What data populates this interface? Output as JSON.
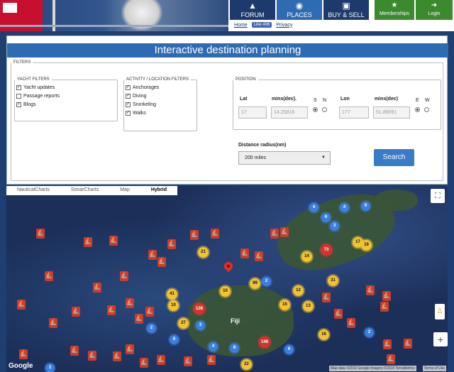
{
  "nav": {
    "tabs": [
      {
        "label": "FORUM",
        "icon": "forum-icon"
      },
      {
        "label": "PLACES",
        "icon": "place-pin-icon"
      },
      {
        "label": "BUY & SELL",
        "icon": "cart-icon"
      }
    ],
    "memberships_label": "Memberships",
    "login_label": "Login",
    "home_link": "Home",
    "like_label": "Like 406",
    "privacy_link": "Privacy"
  },
  "panel": {
    "title": "Interactive destination planning",
    "filters_legend": "FILTERS",
    "yacht_filters": {
      "legend": "YACHT FILTERS",
      "items": [
        {
          "label": "Yacht updates",
          "checked": true
        },
        {
          "label": "Passage reports",
          "checked": false
        },
        {
          "label": "Blogs",
          "checked": true
        }
      ]
    },
    "activity_filters": {
      "legend": "ACTIVITY / LOCATION FILTERS",
      "items": [
        {
          "label": "Anchorages",
          "checked": true
        },
        {
          "label": "Diving",
          "checked": true
        },
        {
          "label": "Snorkeling",
          "checked": true
        },
        {
          "label": "Walks",
          "checked": true
        }
      ]
    },
    "position": {
      "legend": "POSITION",
      "lat_label": "Lat",
      "lat_value": "17",
      "lat_mins_label": "mins(dec).",
      "lat_mins_value": "14.25816",
      "s_label": "S",
      "n_label": "N",
      "lon_label": "Lon",
      "lon_value": "177",
      "lon_mins_label": "mins(dec)",
      "lon_mins_value": "51.86091",
      "e_label": "E",
      "w_label": "W"
    },
    "radius_label": "Distance radius(nm)",
    "radius_value": "200 miles",
    "search_label": "Search"
  },
  "map": {
    "types": [
      "NauticalCharts",
      "SonarCharts",
      "Map",
      "Hybrid"
    ],
    "selected_type": "Hybrid",
    "region_label": "Fiji",
    "google_label": "Google",
    "attribution": "Map data ©2019 Google Imagery ©2019 TerraMetrics",
    "terms": "Terms of Use",
    "zoom_in": "+",
    "fullscreen_icon": "fullscreen-icon",
    "pegman_icon": "street-view-icon",
    "clusters": [
      {
        "n": "4",
        "c": "b"
      },
      {
        "n": "4",
        "c": "b"
      },
      {
        "n": "9",
        "c": "b"
      },
      {
        "n": "6",
        "c": "b"
      },
      {
        "n": "3",
        "c": "b"
      },
      {
        "n": "21",
        "c": "y"
      },
      {
        "n": "17",
        "c": "y"
      },
      {
        "n": "19",
        "c": "y"
      },
      {
        "n": "73",
        "c": "r"
      },
      {
        "n": "14",
        "c": "y"
      },
      {
        "n": "99",
        "c": "y"
      },
      {
        "n": "2",
        "c": "b"
      },
      {
        "n": "10",
        "c": "y"
      },
      {
        "n": "41",
        "c": "y"
      },
      {
        "n": "31",
        "c": "y"
      },
      {
        "n": "15",
        "c": "y"
      },
      {
        "n": "13",
        "c": "y"
      },
      {
        "n": "128",
        "c": "r"
      },
      {
        "n": "10",
        "c": "y"
      },
      {
        "n": "27",
        "c": "y"
      },
      {
        "n": "16",
        "c": "y"
      },
      {
        "n": "148",
        "c": "r"
      },
      {
        "n": "22",
        "c": "y"
      },
      {
        "n": "2",
        "c": "b"
      },
      {
        "n": "3",
        "c": "b"
      },
      {
        "n": "6",
        "c": "b"
      },
      {
        "n": "4",
        "c": "b"
      },
      {
        "n": "2",
        "c": "b"
      },
      {
        "n": "6",
        "c": "b"
      },
      {
        "n": "8",
        "c": "b"
      },
      {
        "n": "12",
        "c": "y"
      },
      {
        "n": "2",
        "c": "b"
      }
    ],
    "markers_count": 40
  }
}
